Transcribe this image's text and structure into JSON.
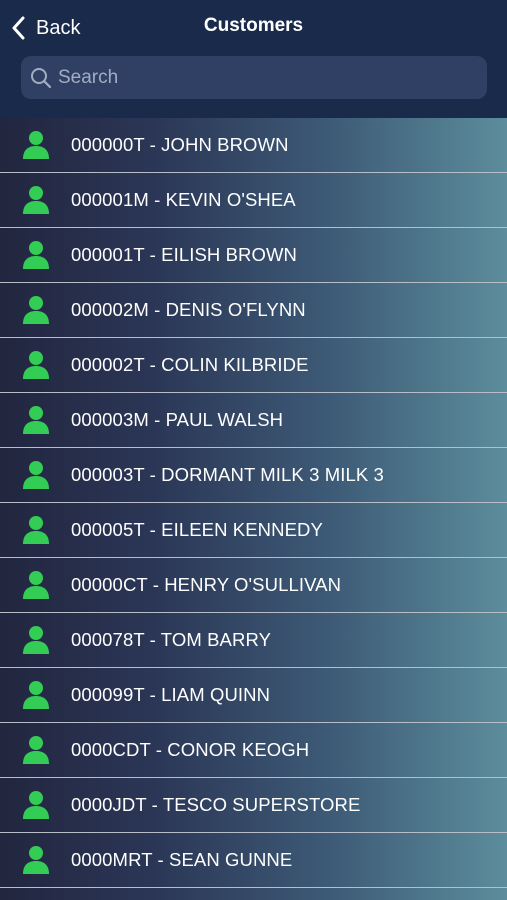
{
  "header": {
    "back_label": "Back",
    "title": "Customers"
  },
  "search": {
    "placeholder": "Search",
    "value": ""
  },
  "colors": {
    "header_bg": "#1a2a4b",
    "search_bg": "#2f4064",
    "avatar_green": "#33cc55"
  },
  "customers": [
    {
      "label": "000000T - JOHN BROWN"
    },
    {
      "label": "000001M - KEVIN O'SHEA"
    },
    {
      "label": "000001T - EILISH BROWN"
    },
    {
      "label": "000002M - DENIS O'FLYNN"
    },
    {
      "label": "000002T - COLIN KILBRIDE"
    },
    {
      "label": "000003M - PAUL WALSH"
    },
    {
      "label": "000003T - DORMANT MILK 3 MILK 3"
    },
    {
      "label": "000005T - EILEEN KENNEDY"
    },
    {
      "label": "00000CT - HENRY O'SULLIVAN"
    },
    {
      "label": "000078T - TOM BARRY"
    },
    {
      "label": "000099T - LIAM QUINN"
    },
    {
      "label": "0000CDT - CONOR KEOGH"
    },
    {
      "label": "0000JDT - TESCO SUPERSTORE"
    },
    {
      "label": "0000MRT - SEAN GUNNE"
    },
    {
      "label": ""
    }
  ]
}
